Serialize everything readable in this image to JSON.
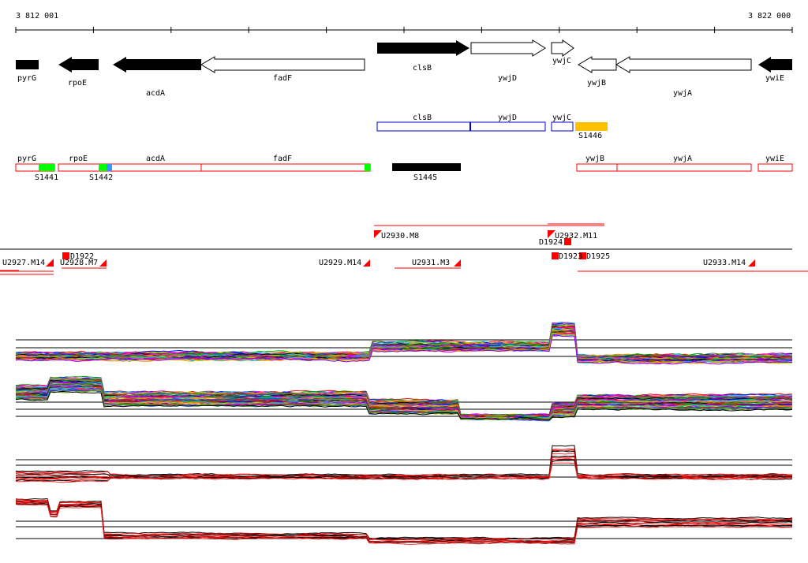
{
  "coords": {
    "start": "3 812 001",
    "end": "3 822 000"
  },
  "genes": [
    {
      "label": "pyrG",
      "fill": "black"
    },
    {
      "label": "rpoE",
      "fill": "black"
    },
    {
      "label": "acdA",
      "fill": "black"
    },
    {
      "label": "fadF",
      "fill": "white"
    },
    {
      "label": "clsB",
      "fill": "black"
    },
    {
      "label": "ywjD",
      "fill": "white"
    },
    {
      "label": "ywjC",
      "fill": "white"
    },
    {
      "label": "ywjB",
      "fill": "white"
    },
    {
      "label": "ywjA",
      "fill": "white"
    },
    {
      "label": "ywiE",
      "fill": "black"
    }
  ],
  "blue_track": {
    "labels": [
      "clsB",
      "ywjD",
      "ywjC"
    ],
    "feature": {
      "label": "S1446",
      "color": "#ffc000"
    }
  },
  "red_track": {
    "labels": [
      "pyrG",
      "rpoE",
      "acdA",
      "fadF",
      "ywjB",
      "ywjA",
      "ywiE"
    ],
    "features": [
      {
        "label": "S1441",
        "color": "#00ff00"
      },
      {
        "label": "S1442",
        "color": "#00ff00"
      },
      {
        "label": "S1445",
        "color": "#000000"
      }
    ]
  },
  "segments": [
    {
      "label": "U2927.M14"
    },
    {
      "label": "D1922"
    },
    {
      "label": "U2928.M7"
    },
    {
      "label": "U2929.M14"
    },
    {
      "label": "U2930.M8"
    },
    {
      "label": "U2931.M3"
    },
    {
      "label": "D1924"
    },
    {
      "label": "U2932.M11"
    },
    {
      "label": "D1923"
    },
    {
      "label": "D1925"
    },
    {
      "label": "U2933.M14"
    }
  ],
  "colors": {
    "feature_red": "#ff0000",
    "feature_blue": "#0000cc"
  }
}
